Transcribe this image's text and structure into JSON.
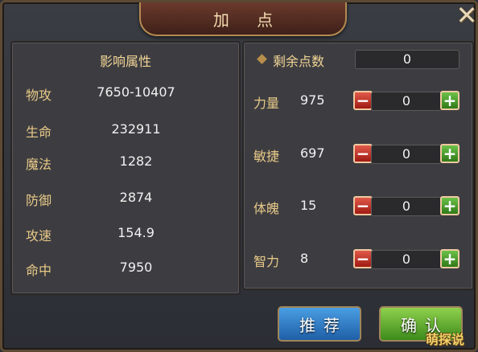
{
  "title": "加 点",
  "close_icon": "close-x-icon",
  "left_panel": {
    "header": "影响属性",
    "rows": [
      {
        "label": "物攻",
        "value": "7650-10407"
      },
      {
        "label": "生命",
        "value": "232911"
      },
      {
        "label": "魔法",
        "value": "1282"
      },
      {
        "label": "防御",
        "value": "2874"
      },
      {
        "label": "攻速",
        "value": "154.9"
      },
      {
        "label": "命中",
        "value": "7950"
      }
    ]
  },
  "right_panel": {
    "remaining_label": "剩余点数",
    "remaining_value": "0",
    "stats": [
      {
        "label": "力量",
        "value": "975",
        "added": "0"
      },
      {
        "label": "敏捷",
        "value": "697",
        "added": "0"
      },
      {
        "label": "体魄",
        "value": "15",
        "added": "0"
      },
      {
        "label": "智力",
        "value": "8",
        "added": "0"
      }
    ],
    "minus_symbol": "−",
    "plus_symbol": "+"
  },
  "buttons": {
    "recommend": "推荐",
    "confirm": "确认"
  },
  "watermark": "萌探说",
  "colors": {
    "label": "#e8c988",
    "header": "#f2d596",
    "recommend_button": "#1f5fa8",
    "confirm_button": "#3d8b1c",
    "minus_button": "#a01a12",
    "plus_button": "#2f7a19"
  }
}
